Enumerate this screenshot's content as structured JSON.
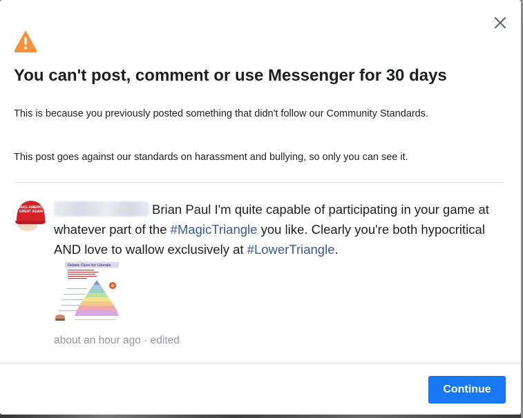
{
  "dialog": {
    "title": "You can't post, comment or use Messenger for 30 days",
    "description": "This is because you previously posted something that didn't follow our Community Standards.",
    "policy_note": "This post goes against our standards on harassment and bullying, so only you can see it.",
    "close_icon": "close-icon",
    "warning_icon": "warning-triangle-icon",
    "warning_color": "#f7923b"
  },
  "post": {
    "text_part1": "Brian Paul I'm quite capable of participating in your game at whatever part of the ",
    "hashtag1": "#MagicTriangle",
    "text_part2": " you like. Clearly you're both hypocritical AND love to wallow exclusively at ",
    "hashtag2": "#LowerTriangle",
    "text_part3": ".",
    "timestamp": "about an hour ago",
    "separator": " · ",
    "edited": "edited",
    "link_color": "#385898"
  },
  "avatar": {
    "hat_text_line1": "MAKE AMERICA",
    "hat_text_line2": "GREAT AGAIN"
  },
  "thumbnail": {
    "title": "Debate Clues for Liberals"
  },
  "footer": {
    "continue_label": "Continue",
    "button_color": "#1877f2"
  }
}
